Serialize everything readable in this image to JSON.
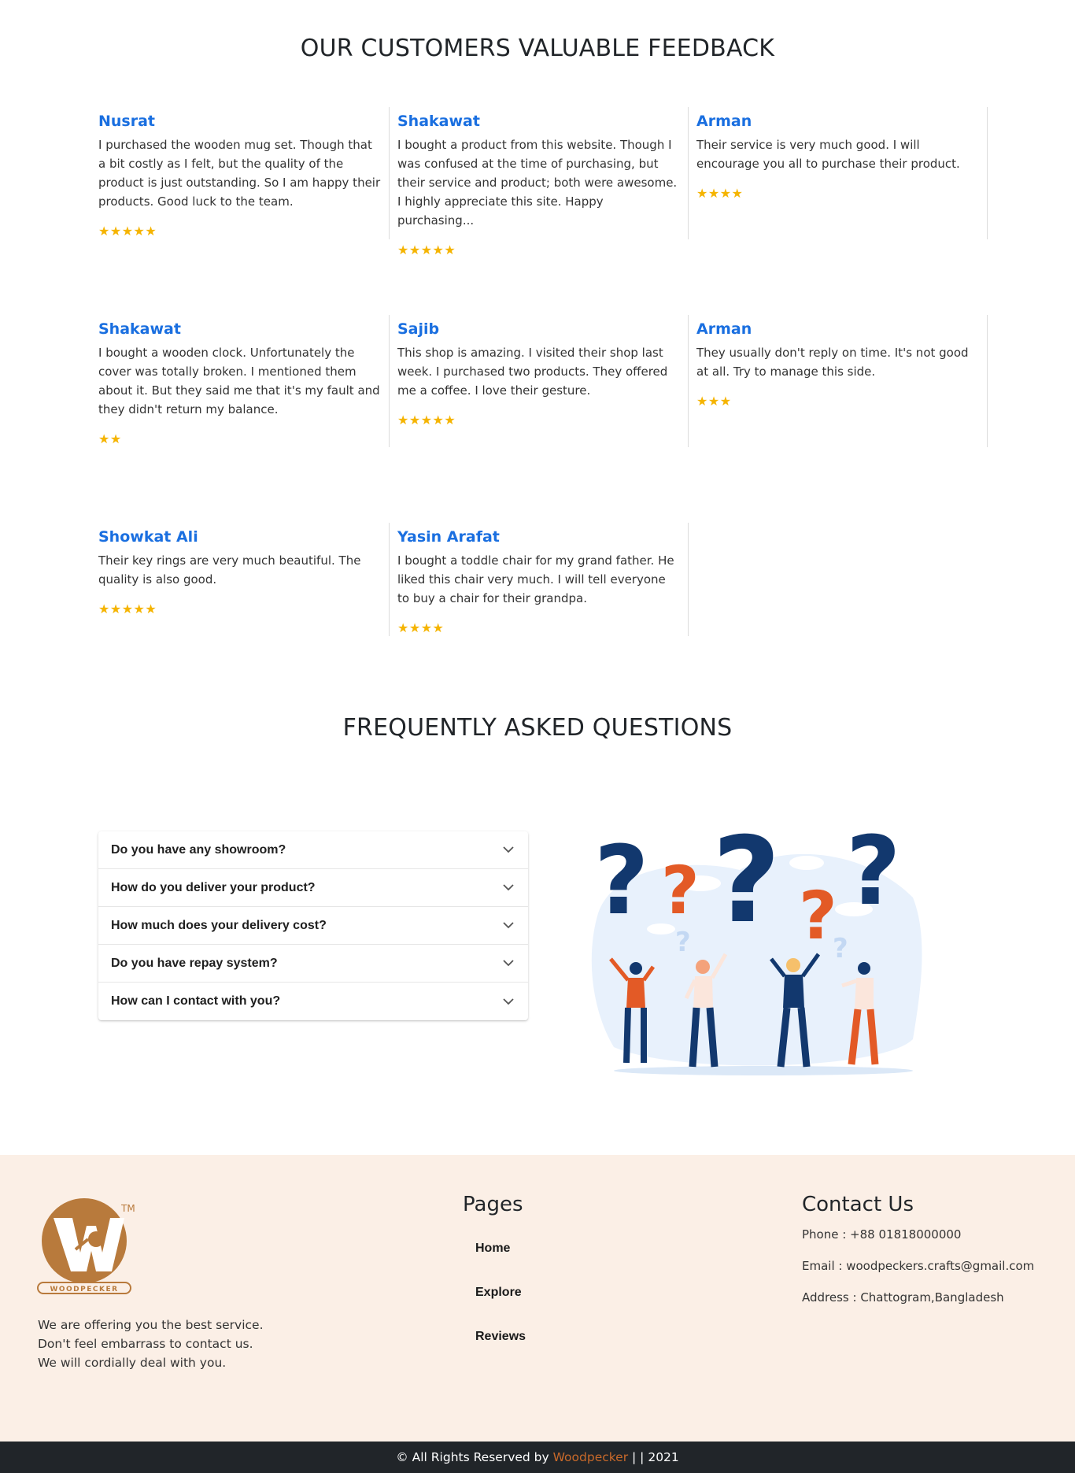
{
  "reviews_section": {
    "title": "OUR CUSTOMERS VALUABLE FEEDBACK",
    "reviews": [
      {
        "name": "Nusrat",
        "text": "I purchased the wooden mug set. Though that a bit costly as I felt, but the quality of the product is just outstanding. So I am happy their products. Good luck to the team.",
        "rating": 5,
        "stars": "★★★★★"
      },
      {
        "name": "Shakawat",
        "text": "I bought a product from this website. Though I was confused at the time of purchasing, but their service and product; both were awesome. I highly appreciate this site. Happy purchasing...",
        "rating": 5,
        "stars": "★★★★★"
      },
      {
        "name": "Arman",
        "text": "Their service is very much good. I will encourage you all to purchase their product.",
        "rating": 4,
        "stars": "★★★★"
      },
      {
        "name": "Shakawat",
        "text": "I bought a wooden clock. Unfortunately the cover was totally broken. I mentioned them about it. But they said me that it's my fault and they didn't return my balance.",
        "rating": 2,
        "stars": "★★"
      },
      {
        "name": "Sajib",
        "text": "This shop is amazing. I visited their shop last week. I purchased two products. They offered me a coffee. I love their gesture.",
        "rating": 5,
        "stars": "★★★★★"
      },
      {
        "name": "Arman",
        "text": "They usually don't reply on time. It's not good at all. Try to manage this side.",
        "rating": 3,
        "stars": "★★★"
      },
      {
        "name": "Showkat Ali",
        "text": "Their key rings are very much beautiful. The quality is also good.",
        "rating": 5,
        "stars": "★★★★★"
      },
      {
        "name": "Yasin Arafat",
        "text": "I bought a toddle chair for my grand father. He liked this chair very much. I will tell everyone to buy a chair for their grandpa.",
        "rating": 4,
        "stars": "★★★★"
      }
    ]
  },
  "faq_section": {
    "title": "FREQUENTLY ASKED QUESTIONS",
    "questions": [
      "Do you have any showroom?",
      "How do you deliver your product?",
      "How much does your delivery cost?",
      "Do you have repay system?",
      "How can I contact with you?"
    ],
    "illustration_icon": "question-marks-people-illustration"
  },
  "footer": {
    "logo": {
      "brand": "WOODPECKER",
      "tm": "TM",
      "icon": "woodpecker-logo-icon"
    },
    "tagline": [
      "We are offering you the best service.",
      "Don't feel embarrass to contact us.",
      "We will cordially deal with you."
    ],
    "pages": {
      "heading": "Pages",
      "links": [
        "Home",
        "Explore",
        "Reviews"
      ]
    },
    "contact": {
      "heading": "Contact Us",
      "phone": "Phone : +88 01818000000",
      "email": "Email : woodpeckers.crafts@gmail.com",
      "address": "Address : Chattogram,Bangladesh"
    }
  },
  "copyright": {
    "prefix": "© All Rights Reserved by",
    "brand": "Woodpecker",
    "suffix": "| | 2021"
  },
  "colors": {
    "reviewer_name": "#1a6fe0",
    "stars": "#f5b400",
    "footer_bg": "#fbefe6",
    "copyright_bg": "#212529",
    "brand_accent": "#c8692a",
    "logo_brown": "#b87a3c"
  }
}
